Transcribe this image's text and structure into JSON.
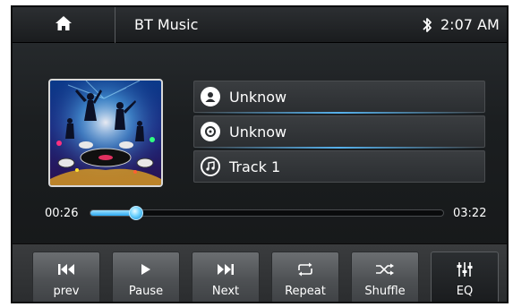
{
  "statusbar": {
    "home_icon": "home-icon",
    "title": "BT Music",
    "bluetooth_icon": "bluetooth-icon",
    "time": "2:07 AM"
  },
  "track": {
    "artist": "Unknow",
    "album": "Unknow",
    "title": "Track 1"
  },
  "progress": {
    "elapsed": "00:26",
    "total": "03:22",
    "fraction": 0.13
  },
  "controls": [
    {
      "label": "prev",
      "icon": "skip-previous-icon"
    },
    {
      "label": "Pause",
      "icon": "play-icon"
    },
    {
      "label": "Next",
      "icon": "skip-next-icon"
    },
    {
      "label": "Repeat",
      "icon": "repeat-icon"
    },
    {
      "label": "Shuffle",
      "icon": "shuffle-icon"
    },
    {
      "label": "EQ",
      "icon": "equalizer-icon"
    }
  ],
  "colors": {
    "accent": "#2aa8f0",
    "background": "#1b1e20",
    "text": "#ffffff"
  }
}
